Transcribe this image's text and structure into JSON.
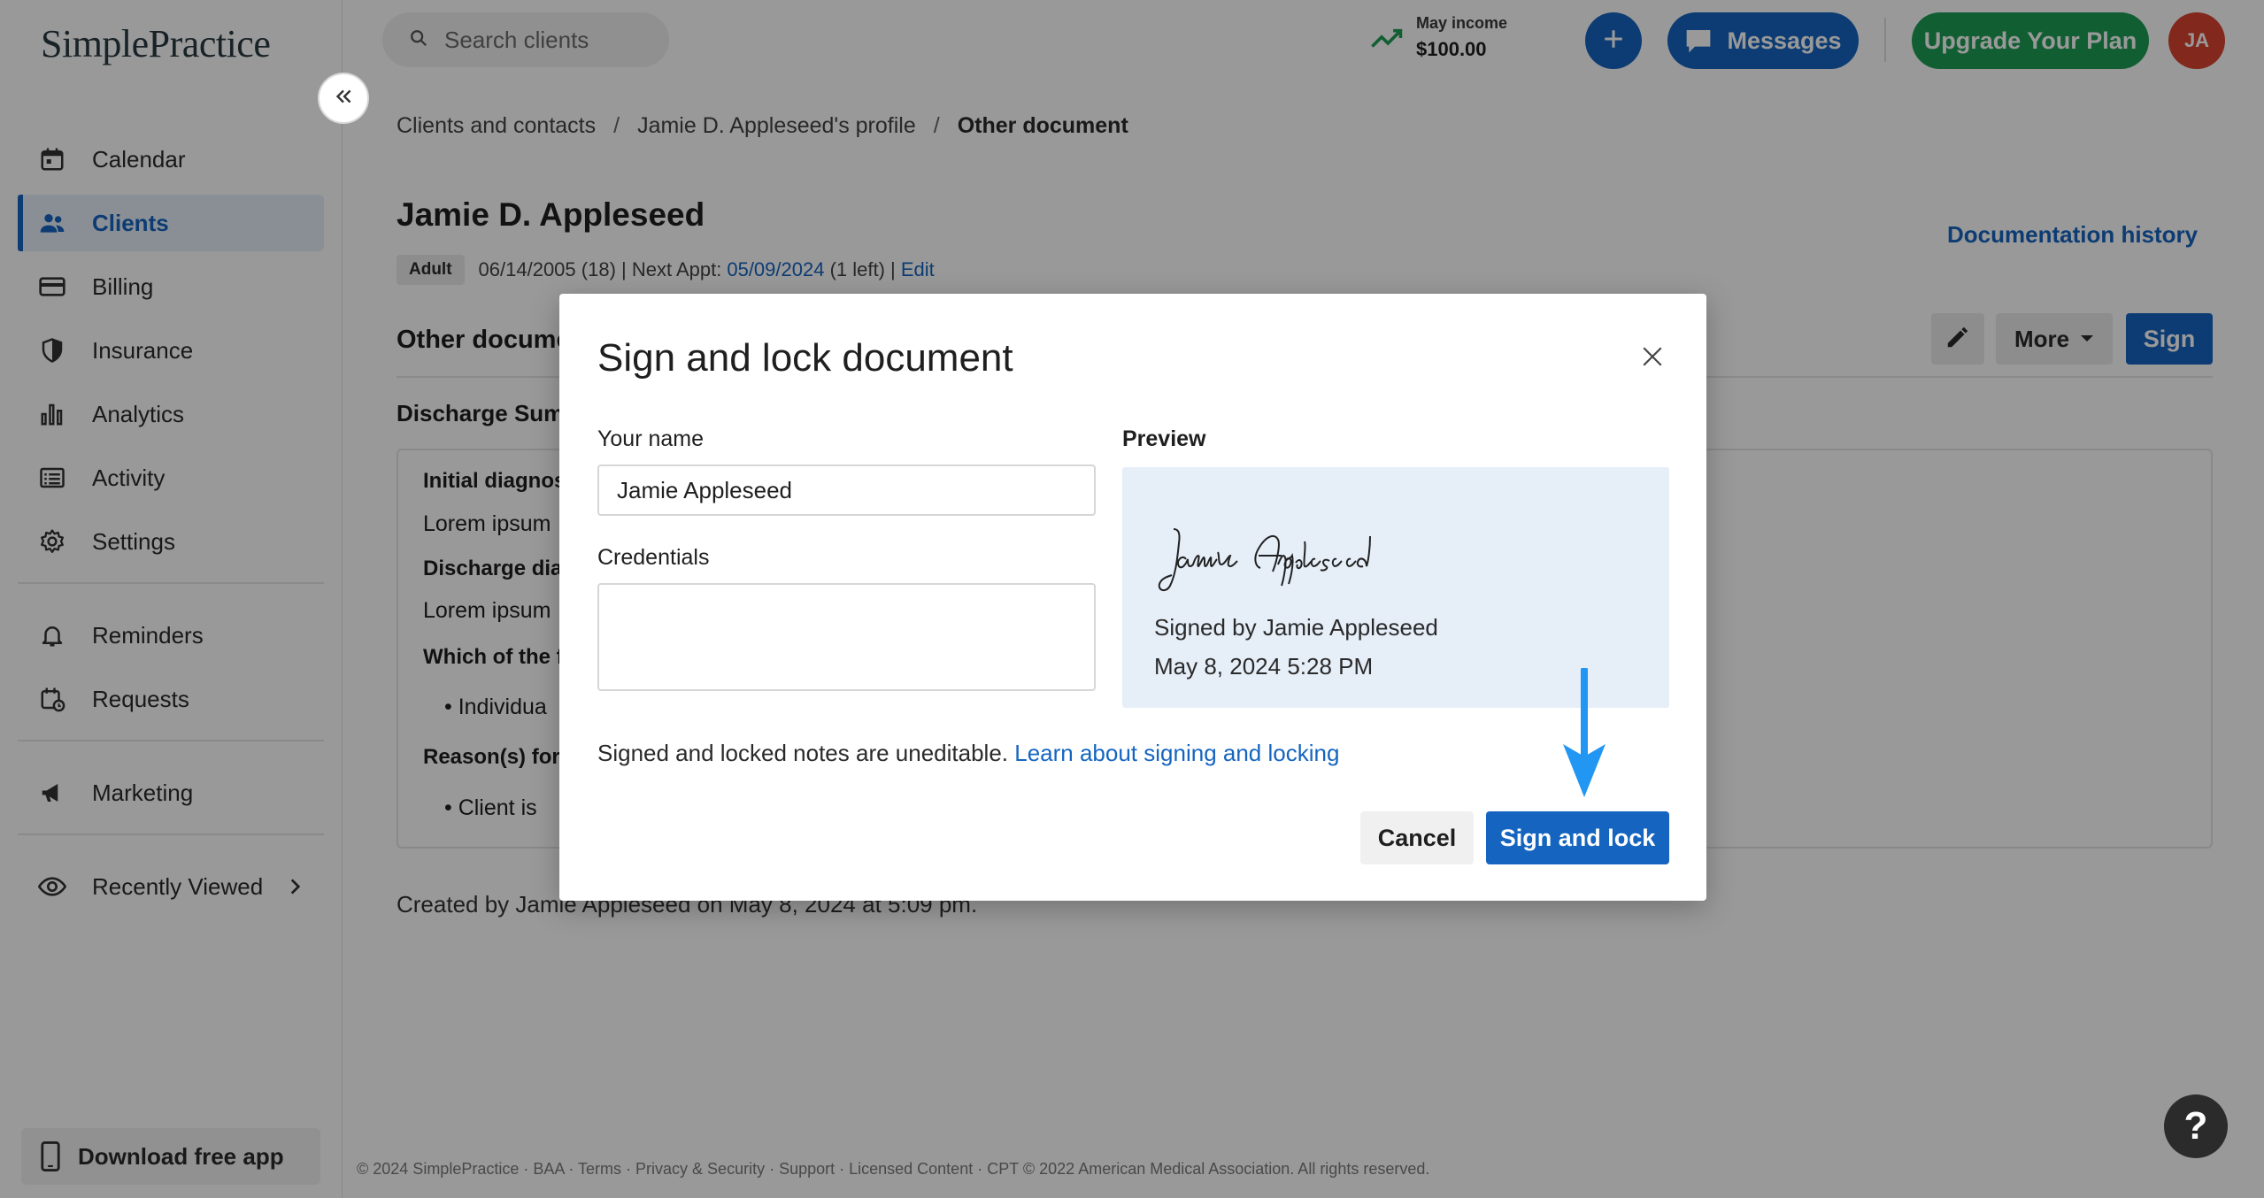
{
  "app": {
    "logo": "SimplePractice"
  },
  "sidebar": {
    "items": [
      {
        "label": "Calendar",
        "icon": "calendar-icon"
      },
      {
        "label": "Clients",
        "icon": "people-icon",
        "active": true
      },
      {
        "label": "Billing",
        "icon": "credit-card-icon"
      },
      {
        "label": "Insurance",
        "icon": "shield-icon"
      },
      {
        "label": "Analytics",
        "icon": "bar-chart-icon"
      },
      {
        "label": "Activity",
        "icon": "list-icon"
      },
      {
        "label": "Settings",
        "icon": "gear-icon"
      },
      {
        "label": "Reminders",
        "icon": "bell-icon"
      },
      {
        "label": "Requests",
        "icon": "calendar-request-icon"
      },
      {
        "label": "Marketing",
        "icon": "megaphone-icon"
      },
      {
        "label": "Recently Viewed",
        "icon": "eye-icon"
      }
    ],
    "download_label": "Download free app"
  },
  "topbar": {
    "search_placeholder": "Search clients",
    "income_label": "May income",
    "income_value": "$100.00",
    "messages_label": "Messages",
    "upgrade_label": "Upgrade Your Plan",
    "avatar_initials": "JA"
  },
  "breadcrumb": {
    "items": [
      "Clients and contacts",
      "Jamie D. Appleseed's profile",
      "Other document"
    ],
    "separator": "/"
  },
  "client": {
    "name": "Jamie D. Appleseed",
    "badge": "Adult",
    "meta_prefix": "06/14/2005 (18) | Next Appt: ",
    "next_appt": "05/09/2024",
    "meta_suffix": " (1 left) | ",
    "edit_label": "Edit"
  },
  "doc_history_label": "Documentation history",
  "document": {
    "section_title": "Other docume",
    "more_label": "More",
    "sign_label": "Sign",
    "subtitle": "Discharge Sum",
    "fields": [
      {
        "text": "Initial diagnos",
        "bold": true
      },
      {
        "text": "Lorem ipsum",
        "bold": false
      },
      {
        "text": "Discharge dia",
        "bold": true
      },
      {
        "text": "Lorem ipsum",
        "bold": false
      },
      {
        "text": "Which of the f",
        "bold": true
      },
      {
        "text": "Individua",
        "bold": false
      },
      {
        "text": "Reason(s) for",
        "bold": true
      },
      {
        "text": "Client is",
        "bold": false
      }
    ],
    "created_text": "Created by Jamie Appleseed on May 8, 2024 at 5:09 pm."
  },
  "footer": "© 2024 SimplePractice · BAA · Terms · Privacy & Security · Support · Licensed Content · CPT © 2022 American Medical Association. All rights reserved.",
  "help_label": "?",
  "modal": {
    "title": "Sign and lock document",
    "name_label": "Your name",
    "name_value": "Jamie Appleseed",
    "credentials_label": "Credentials",
    "credentials_value": "",
    "preview_label": "Preview",
    "signature_text": "Jamie Appleseed",
    "signed_by": "Signed by Jamie Appleseed",
    "signed_date": "May 8, 2024 5:28 PM",
    "note": "Signed and locked notes are uneditable. ",
    "learn_link": "Learn about signing and locking",
    "cancel_label": "Cancel",
    "sign_lock_label": "Sign and lock"
  },
  "colors": {
    "primary": "#1565c0",
    "upgrade": "#1f9d55",
    "avatar": "#d9432f",
    "preview_bg": "#e6eef8",
    "arrow": "#2196f3"
  }
}
